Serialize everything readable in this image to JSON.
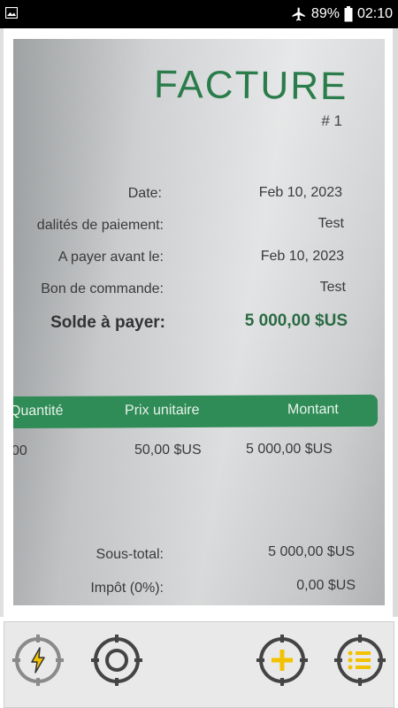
{
  "status_bar": {
    "battery": "89%",
    "time": "02:10",
    "icons": [
      "gallery-icon",
      "airplane-mode-icon",
      "battery-icon"
    ]
  },
  "invoice": {
    "title": "FACTURE",
    "number": "# 1",
    "fields": [
      {
        "label": "Date:",
        "value": "Feb 10, 2023"
      },
      {
        "label": "dalités de paiement:",
        "value": "Test"
      },
      {
        "label": "A payer avant le:",
        "value": "Feb 10, 2023"
      },
      {
        "label": "Bon de commande:",
        "value": "Test"
      }
    ],
    "balance": {
      "label": "Solde à payer:",
      "value": "5 000,00 $US"
    },
    "table": {
      "headers": [
        "Quantité",
        "Prix unitaire",
        "Montant"
      ],
      "row": {
        "quantity": "00",
        "unit_price": "50,00 $US",
        "amount": "5 000,00 $US"
      }
    },
    "subtotal": {
      "label": "Sous-total:",
      "value": "5 000,00 $US"
    },
    "tax": {
      "label": "Impôt (0%):",
      "value": "0,00 $US"
    }
  },
  "toolbar": {
    "buttons": [
      {
        "name": "flash-button",
        "icon": "flash-icon"
      },
      {
        "name": "focus-button",
        "icon": "focus-target-icon"
      },
      {
        "name": "add-page-button",
        "icon": "add-icon"
      },
      {
        "name": "pages-list-button",
        "icon": "list-icon"
      }
    ],
    "colors": {
      "ring": "#555555",
      "accent": "#f2c200",
      "panel": "#e9e9e9"
    }
  },
  "colors": {
    "invoice_green": "#2a7c4a",
    "table_header_green": "#2f8c56"
  }
}
